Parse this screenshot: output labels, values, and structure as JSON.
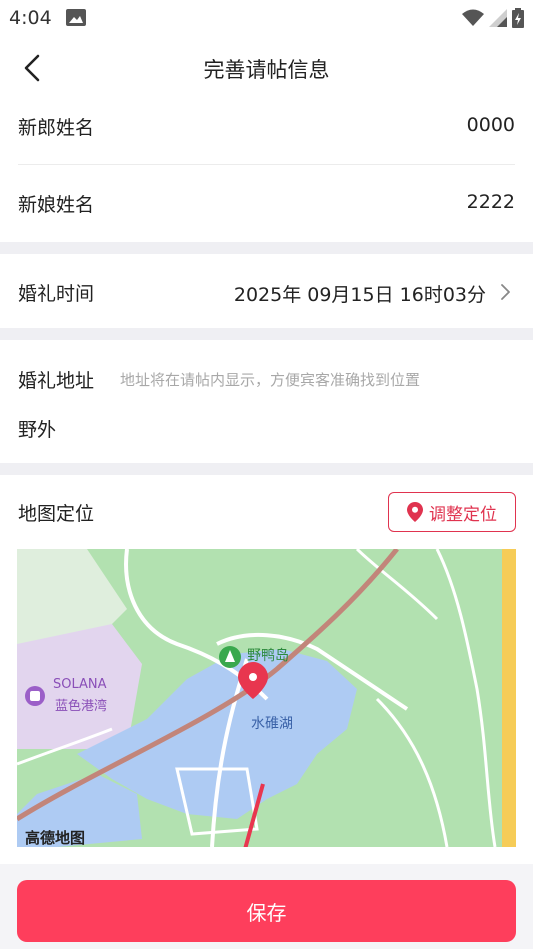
{
  "status_bar": {
    "time": "4:04"
  },
  "nav": {
    "title": "完善请帖信息"
  },
  "groom": {
    "label": "新郎姓名",
    "value": "0000"
  },
  "bride": {
    "label": "新娘姓名",
    "value": "2222"
  },
  "wedding_time": {
    "label": "婚礼时间",
    "value": "2025年 09月15日 16时03分"
  },
  "wedding_address": {
    "label": "婚礼地址",
    "hint": "地址将在请帖内显示，方便宾客准确找到位置",
    "value": "野外"
  },
  "map_location": {
    "label": "地图定位",
    "adjust_button": "调整定位",
    "map_labels": {
      "island": "野鸭岛",
      "lake": "水碓湖",
      "mall_en": "SOLANA",
      "mall_cn": "蓝色港湾",
      "provider": "高德地图"
    }
  },
  "save_button": "保存",
  "colors": {
    "accent": "#fe3e5c",
    "accent_border": "#e0334f",
    "map_green": "#b2e1b0",
    "map_water": "#aecbf3",
    "map_pin": "#e8364f"
  },
  "icons": {
    "back": "chevron-left-icon",
    "chevron": "chevron-right-icon",
    "location": "location-pin-icon",
    "map_pin": "map-marker-icon"
  }
}
